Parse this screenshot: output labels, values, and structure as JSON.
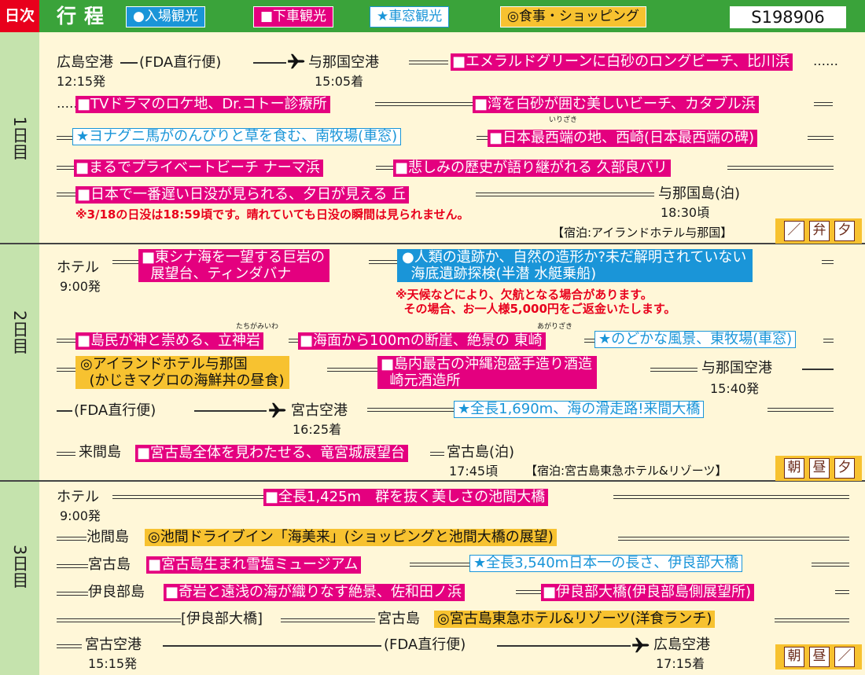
{
  "header": {
    "day_label": "日次",
    "title": "行程",
    "legend": [
      "●入場観光",
      "■下車観光",
      "★車窓観光",
      "◎食事・ショッピング"
    ],
    "tour_code": "S198906"
  },
  "days": [
    {
      "label": "1日目"
    },
    {
      "label": "2日目"
    },
    {
      "label": "3日目"
    }
  ],
  "d1": {
    "a": "広島空港",
    "a_time": "12:15発",
    "flight": "(FDA直行便)",
    "b": "与那国空港",
    "b_time": "15:05着",
    "s1": "■エメラルドグリーンに白砂のロングビーチ、比川浜",
    "dots": "……",
    "s2": "■TVドラマのロケ地、Dr.コトー診療所",
    "s3": "■湾を白砂が囲む美しいビーチ、カタブル浜",
    "s4": "★ヨナグニ馬がのんびりと草を食む、南牧場(車窓)",
    "s5": "■日本最西端の地、西崎(日本最西端の碑)",
    "ruby_irizaki": "いりざき",
    "s6": "■まるでプライベートビーチ ナーマ浜",
    "s7": "■悲しみの歴史が語り継がれる 久部良バリ",
    "s8": "■日本で一番遅い日没が見られる、夕日が見える 丘",
    "end": "与那国島(泊)",
    "end_time": "18:30頃",
    "note": "※3/18の日没は18:59頃です。晴れていても日没の瞬間は見られません。",
    "hotel": "【宿泊:アイランドホテル与那国】",
    "meals": [
      "／",
      "弁",
      "夕"
    ]
  },
  "d2": {
    "start": "ホテル",
    "start_time": "9:00発",
    "s1": "■東シナ海を一望する巨岩の\n  展望台、ティンダバナ",
    "s2": "●人類の遺跡か、自然の造形か?未だ解明されていない\n  海底遺跡探検(半潜 水艇乗船)",
    "note": "※天候などにより、欠航となる場合があります。\n  その場合、お一人様5,000円をご返金いたします。",
    "s3": "■島民が神と崇める、立神岩",
    "ruby_tachigami": "たちがみいわ",
    "s4": "■海面から100mの断崖、絶景の 東崎",
    "ruby_agari": "あがりざき",
    "s5": "★のどかな風景、東牧場(車窓)",
    "meal": "◎アイランドホテル与那国\n  (かじきマグロの海鮮丼の昼食)",
    "s6": "■島内最古の沖縄泡盛手造り酒造\n  崎元酒造所",
    "apt": "与那国空港",
    "apt_time": "15:40発",
    "flight": "(FDA直行便)",
    "b": "宮古空港",
    "b_time": "16:25着",
    "s7": "★全長1,690m、海の滑走路!来間大橋",
    "kurima": "来間島",
    "s8": "■宮古島全体を見わたせる、竜宮城展望台",
    "end": "宮古島(泊)",
    "end_time": "17:45頃",
    "hotel": "【宿泊:宮古島東急ホテル&リゾーツ】",
    "meals": [
      "朝",
      "昼",
      "夕"
    ]
  },
  "d3": {
    "start": "ホテル",
    "start_time": "9:00発",
    "s1": "■全長1,425m　群を抜く美しさの池間大橋",
    "ikema": "池間島",
    "s2": "◎池間ドライブイン「海美来」(ショッピングと池間大橋の展望)",
    "miyako": "宮古島",
    "s3": "■宮古島生まれ雪塩ミュージアム",
    "s4": "★全長3,540m日本一の長さ、伊良部大橋",
    "irabu": "伊良部島",
    "s5": "■奇岩と遠浅の海が織りなす絶景、佐和田ノ浜",
    "s6": "■伊良部大橋(伊良部島側展望所)",
    "bridge": "[伊良部大橋]",
    "miyako2": "宮古島",
    "s7": "◎宮古島東急ホテル&リゾーツ(洋食ランチ)",
    "apt": "宮古空港",
    "apt_time": "15:15発",
    "flight": "(FDA直行便)",
    "end": "広島空港",
    "end_time": "17:15着",
    "meals": [
      "朝",
      "昼",
      "／"
    ]
  },
  "colors": {
    "green": "#3aa33a",
    "red": "#e8001c",
    "magenta": "#e4007f",
    "blue": "#1a95d8",
    "yellow": "#f7c230",
    "cream": "#fff7d8",
    "daycol": "#c5e3ad"
  },
  "icons": [
    "airplane-icon"
  ]
}
